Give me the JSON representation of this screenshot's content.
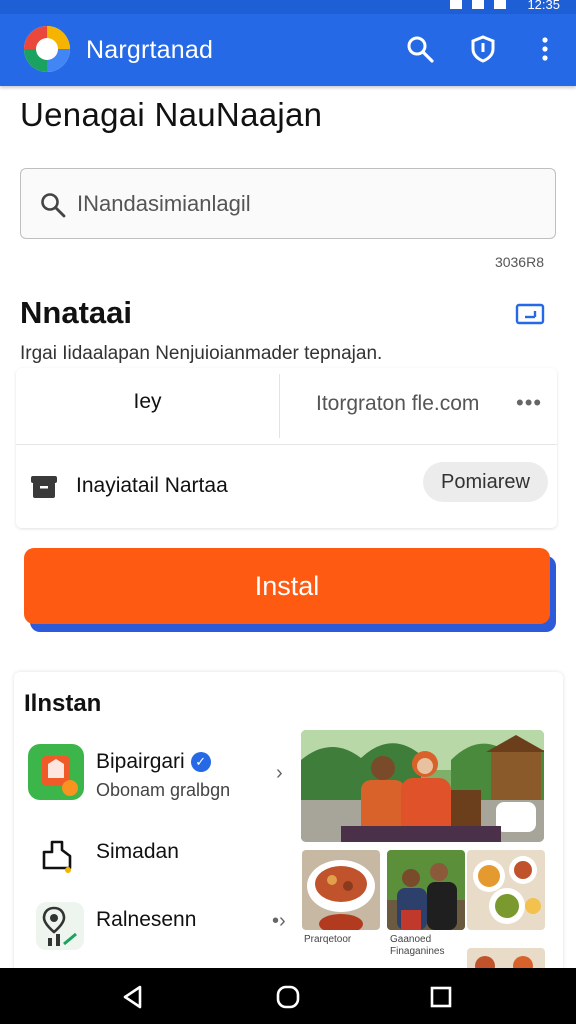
{
  "status_bar": {
    "time": "12:35"
  },
  "app_bar": {
    "title": "Nargrtanad"
  },
  "page": {
    "heading": "Uenagai NauNaajan"
  },
  "search": {
    "placeholder": "INandasimianlagil",
    "value": ""
  },
  "counter": "3036R8",
  "section": {
    "title": "Nnataai",
    "description": "Irgai Iidaalapan Nenjuioianmader tepnajan."
  },
  "info_card": {
    "left_cell": "Iey",
    "right_cell": "Itorgraton fle.com",
    "row_label": "Inayiatail Nartaa",
    "chip_label": "Pomiarew"
  },
  "install_button": {
    "label": "Instal"
  },
  "list": {
    "title": "Ilnstan",
    "items": [
      {
        "name": "Bipairgari",
        "subtitle": "Obonam gralbgn",
        "verified": true,
        "icon": "app-tile-icon"
      },
      {
        "name": "Simadan",
        "icon": "building-outline-icon"
      },
      {
        "name": "Ralnesenn",
        "icon": "map-pin-chart-icon"
      }
    ],
    "thumb_captions": [
      "Prarqetoor",
      "Gaanoed Finaganines"
    ]
  },
  "colors": {
    "app_bar": "#2569e6",
    "accent_orange": "#ff5a12",
    "button_shadow": "#2c5ad8",
    "nav_bar": "#000000"
  }
}
